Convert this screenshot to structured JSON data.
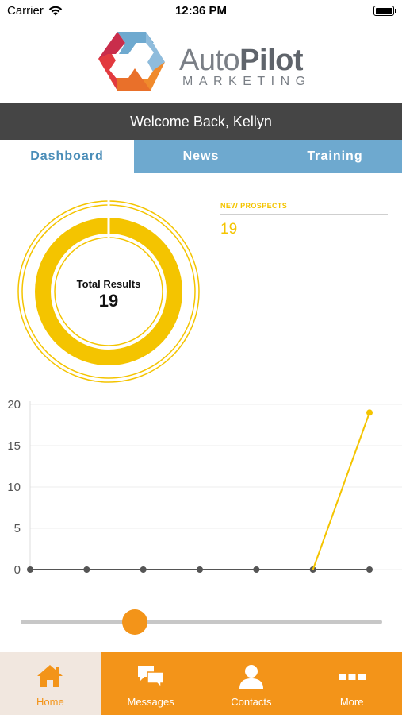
{
  "status_bar": {
    "carrier": "Carrier",
    "time": "12:36 PM",
    "icons": [
      "wifi-icon",
      "battery-icon"
    ]
  },
  "brand": {
    "name_light": "Auto",
    "name_bold": "Pilot",
    "tagline": "MARKETING",
    "colors": {
      "red": "#e23a3f",
      "blue": "#6ea9cf",
      "orange": "#f08a2c",
      "grey": "#7a7f86"
    }
  },
  "welcome": {
    "text": "Welcome Back, Kellyn"
  },
  "tabs": [
    {
      "label": "Dashboard",
      "active": true
    },
    {
      "label": "News",
      "active": false
    },
    {
      "label": "Training",
      "active": false
    }
  ],
  "summary": {
    "total_label": "Total Results",
    "total_value": "19",
    "prospects_label": "NEW PROSPECTS",
    "prospects_value": "19",
    "ring_fraction": 1.0,
    "accent_color": "#f4c400"
  },
  "chart_data": {
    "type": "line",
    "x": [
      1,
      2,
      3,
      4,
      5,
      6,
      7
    ],
    "series": [
      {
        "values": [
          0,
          0,
          0,
          0,
          0,
          0,
          19
        ],
        "color": "#f4c400"
      },
      {
        "values": [
          0,
          0,
          0,
          0,
          0,
          0,
          0
        ],
        "color": "#555555"
      }
    ],
    "y_ticks": [
      "0",
      "5",
      "10",
      "15",
      "20"
    ],
    "ylim": [
      0,
      20
    ],
    "grid": true,
    "title": "",
    "xlabel": "",
    "ylabel": ""
  },
  "slider": {
    "value_fraction": 0.315
  },
  "tabbar": {
    "items": [
      {
        "label": "Home",
        "icon": "home-icon",
        "active": true
      },
      {
        "label": "Messages",
        "icon": "messages-icon",
        "active": false
      },
      {
        "label": "Contacts",
        "icon": "contacts-icon",
        "active": false
      },
      {
        "label": "More",
        "icon": "more-icon",
        "active": false
      }
    ],
    "colors": {
      "bar": "#f39419",
      "active_bg": "#f1e7df"
    }
  }
}
